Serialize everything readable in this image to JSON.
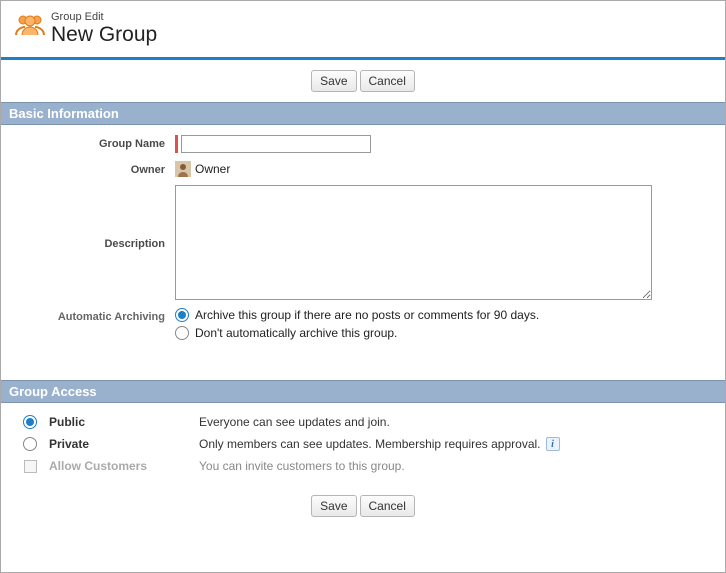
{
  "header": {
    "sup": "Group Edit",
    "title": "New Group"
  },
  "buttons": {
    "save": "Save",
    "cancel": "Cancel"
  },
  "sections": {
    "basic": "Basic Information",
    "access": "Group Access"
  },
  "labels": {
    "groupName": "Group Name",
    "owner": "Owner",
    "description": "Description",
    "autoArchive": "Automatic Archiving"
  },
  "fields": {
    "groupName_value": "",
    "description_value": ""
  },
  "owner": {
    "name": "Owner"
  },
  "archiving": {
    "opt90": "Archive this group if there are no posts or comments for 90 days.",
    "optNever": "Don't automatically archive this group.",
    "selected": "opt90"
  },
  "access": {
    "public": {
      "label": "Public",
      "desc": "Everyone can see updates and join."
    },
    "private": {
      "label": "Private",
      "desc": "Only members can see updates. Membership requires approval."
    },
    "allow": {
      "label": "Allow Customers",
      "desc": "You can invite customers to this group."
    },
    "selected": "public"
  },
  "info_glyph": "i"
}
